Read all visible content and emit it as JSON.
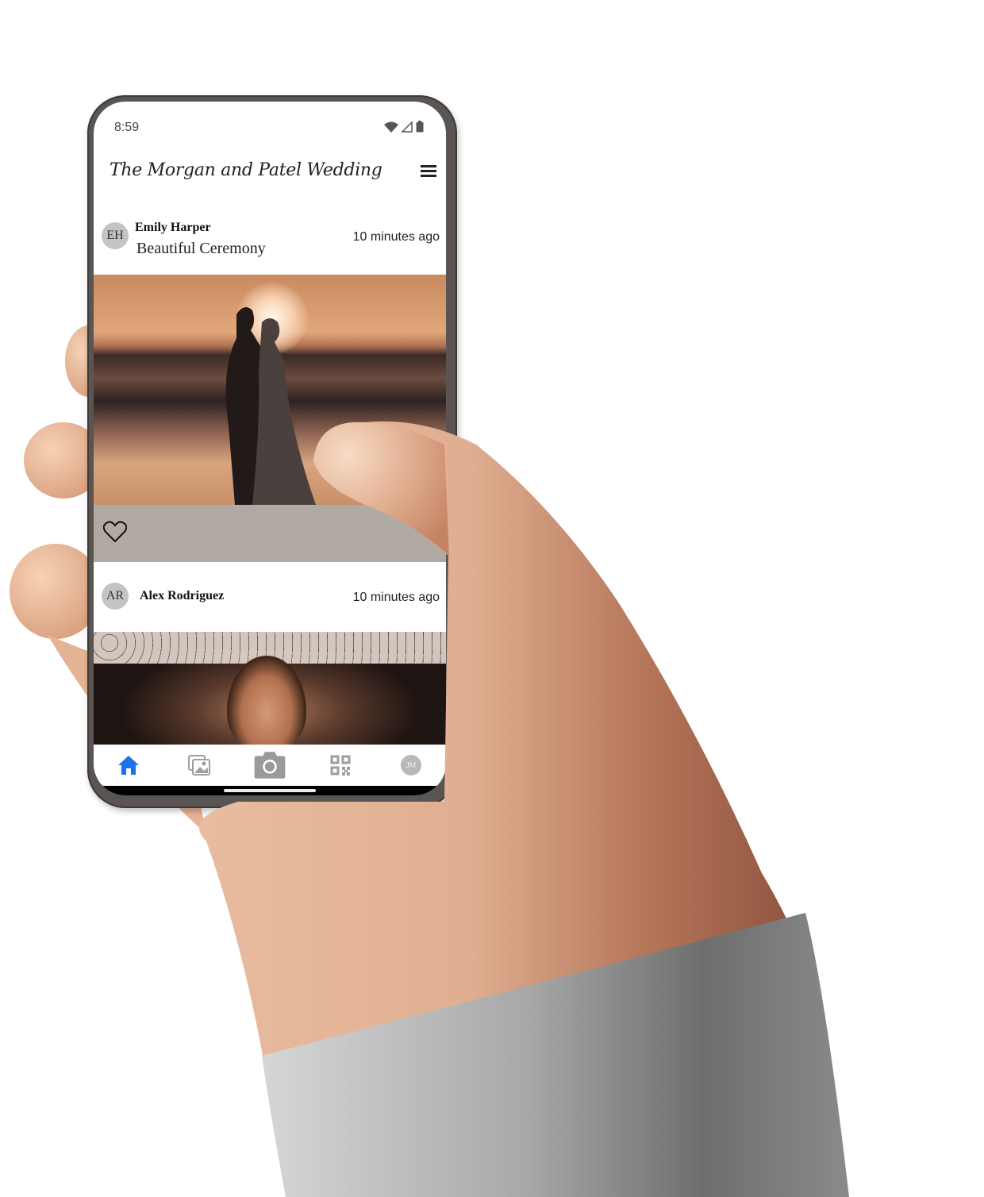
{
  "status_bar": {
    "time": "8:59",
    "icons": [
      "wifi-icon",
      "signal-icon",
      "battery-icon"
    ]
  },
  "app_bar": {
    "title": "The Morgan and Patel Wedding",
    "menu_icon": "hamburger-menu-icon"
  },
  "feed": {
    "posts": [
      {
        "initials": "EH",
        "author": "Emily Harper",
        "caption": "Beautiful Ceremony",
        "time_ago": "10 minutes ago",
        "photo": "Couple kissing on beach at sunset",
        "liked": false
      },
      {
        "initials": "AR",
        "author": "Alex Rodriguez",
        "caption": "",
        "time_ago": "10 minutes ago",
        "photo": "Smiling woman at reception under string lights"
      }
    ]
  },
  "bottom_nav": {
    "items": [
      {
        "name": "home",
        "icon": "home-icon",
        "active": true
      },
      {
        "name": "gallery",
        "icon": "gallery-icon",
        "active": false
      },
      {
        "name": "camera",
        "icon": "camera-icon",
        "active": false
      },
      {
        "name": "qr-code",
        "icon": "qr-code-icon",
        "active": false
      },
      {
        "name": "profile",
        "icon": "avatar",
        "initials": "JM",
        "active": false
      }
    ]
  },
  "colors": {
    "active_nav": "#1a73e8",
    "inactive_nav": "#9e9e9e",
    "avatar_bg": "#c4c4c4"
  }
}
